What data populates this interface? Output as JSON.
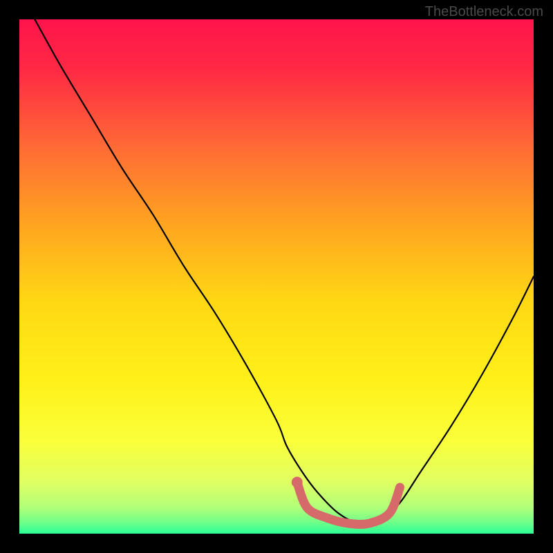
{
  "watermark": "TheBottleneck.com",
  "colors": {
    "gradient_stops": [
      {
        "offset": 0.0,
        "color": "#ff144b"
      },
      {
        "offset": 0.1,
        "color": "#ff2a44"
      },
      {
        "offset": 0.25,
        "color": "#ff6b35"
      },
      {
        "offset": 0.4,
        "color": "#ffa520"
      },
      {
        "offset": 0.55,
        "color": "#ffd814"
      },
      {
        "offset": 0.7,
        "color": "#fff019"
      },
      {
        "offset": 0.82,
        "color": "#faff3a"
      },
      {
        "offset": 0.9,
        "color": "#e0ff63"
      },
      {
        "offset": 0.95,
        "color": "#b0ff7a"
      },
      {
        "offset": 0.98,
        "color": "#6bff8a"
      },
      {
        "offset": 1.0,
        "color": "#2bfd96"
      }
    ],
    "curve": "#000000",
    "highlight": "#d66a6a"
  },
  "chart_data": {
    "type": "line",
    "title": "",
    "xlabel": "",
    "ylabel": "",
    "xlim": [
      0,
      100
    ],
    "ylim": [
      0,
      100
    ],
    "grid": false,
    "legend": false,
    "series": [
      {
        "name": "curve",
        "x": [
          3,
          8,
          14,
          20,
          26,
          32,
          38,
          44,
          50,
          52,
          55,
          58,
          62,
          66,
          70,
          74,
          78,
          84,
          90,
          96,
          100
        ],
        "y": [
          100,
          91,
          81,
          71,
          62,
          52,
          43,
          33,
          22,
          17,
          12,
          8,
          4,
          2,
          2,
          6,
          12,
          21,
          31,
          42,
          50
        ]
      }
    ],
    "highlight_segment": {
      "name": "optimal-zone",
      "x": [
        54,
        56,
        60,
        64,
        68,
        72,
        74
      ],
      "y": [
        10,
        5,
        3,
        2,
        2,
        4,
        9
      ]
    }
  }
}
